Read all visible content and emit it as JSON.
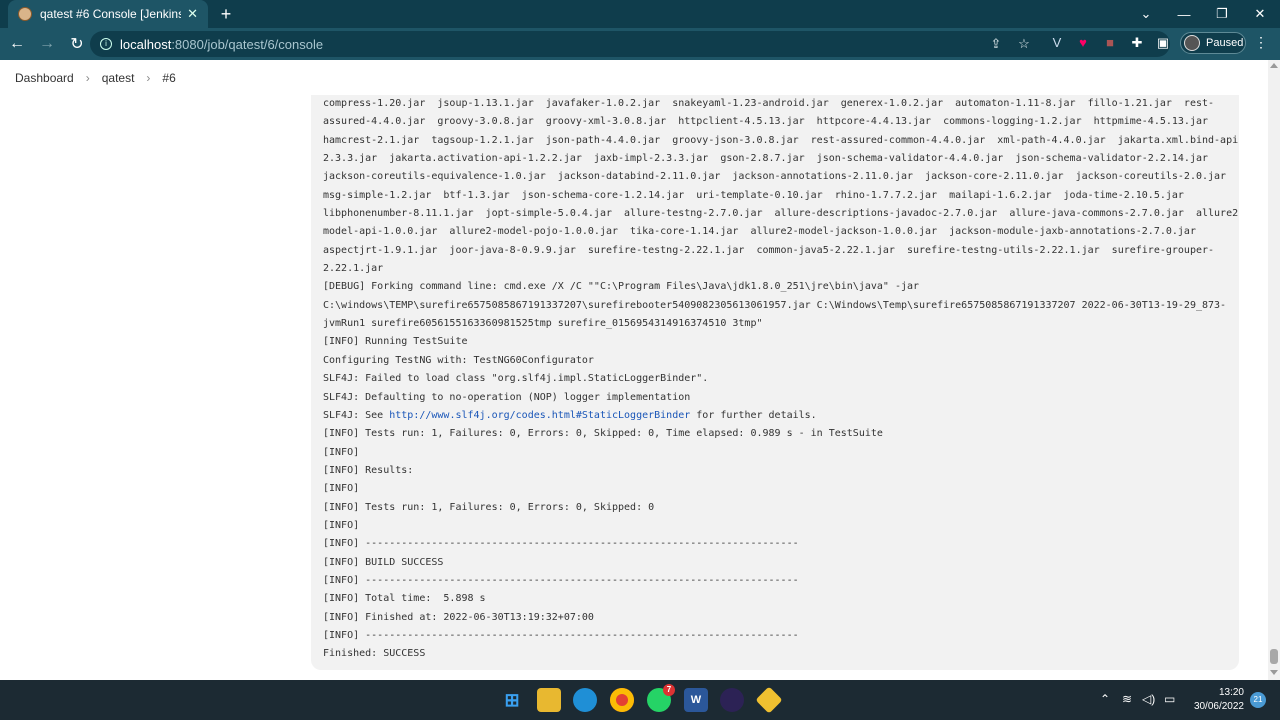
{
  "browser": {
    "tab_title": "qatest #6 Console [Jenkins]",
    "tab_close": "✕",
    "new_tab": "+",
    "url_host": "localhost",
    "url_path": ":8080/job/qatest/6/console",
    "profile_label": "Paused"
  },
  "breadcrumb": {
    "items": [
      "Dashboard",
      "qatest",
      "#6"
    ],
    "separator": "›"
  },
  "console": {
    "lines": [
      "compress-1.20.jar  jsoup-1.13.1.jar  javafaker-1.0.2.jar  snakeyaml-1.23-android.jar  generex-1.0.2.jar  automaton-1.11-8.jar  fillo-1.21.jar  rest-",
      "assured-4.4.0.jar  groovy-3.0.8.jar  groovy-xml-3.0.8.jar  httpclient-4.5.13.jar  httpcore-4.4.13.jar  commons-logging-1.2.jar  httpmime-4.5.13.jar",
      "hamcrest-2.1.jar  tagsoup-1.2.1.jar  json-path-4.4.0.jar  groovy-json-3.0.8.jar  rest-assured-common-4.4.0.jar  xml-path-4.4.0.jar  jakarta.xml.bind-api-",
      "2.3.3.jar  jakarta.activation-api-1.2.2.jar  jaxb-impl-2.3.3.jar  gson-2.8.7.jar  json-schema-validator-4.4.0.jar  json-schema-validator-2.2.14.jar",
      "jackson-coreutils-equivalence-1.0.jar  jackson-databind-2.11.0.jar  jackson-annotations-2.11.0.jar  jackson-core-2.11.0.jar  jackson-coreutils-2.0.jar",
      "msg-simple-1.2.jar  btf-1.3.jar  json-schema-core-1.2.14.jar  uri-template-0.10.jar  rhino-1.7.7.2.jar  mailapi-1.6.2.jar  joda-time-2.10.5.jar",
      "libphonenumber-8.11.1.jar  jopt-simple-5.0.4.jar  allure-testng-2.7.0.jar  allure-descriptions-javadoc-2.7.0.jar  allure-java-commons-2.7.0.jar  allure2-",
      "model-api-1.0.0.jar  allure2-model-pojo-1.0.0.jar  tika-core-1.14.jar  allure2-model-jackson-1.0.0.jar  jackson-module-jaxb-annotations-2.7.0.jar",
      "aspectjrt-1.9.1.jar  joor-java-8-0.9.9.jar  surefire-testng-2.22.1.jar  common-java5-2.22.1.jar  surefire-testng-utils-2.22.1.jar  surefire-grouper-",
      "2.22.1.jar",
      "[DEBUG] Forking command line: cmd.exe /X /C \"\"C:\\Program Files\\Java\\jdk1.8.0_251\\jre\\bin\\java\" -jar",
      "C:\\windows\\TEMP\\surefire6575085867191337207\\surefirebooter5409082305613061957.jar C:\\Windows\\Temp\\surefire6575085867191337207 2022-06-30T13-19-29_873-",
      "jvmRun1 surefire6056155163360981525tmp surefire_0156954314916374510 3tmp\"",
      "[INFO] Running TestSuite",
      "Configuring TestNG with: TestNG60Configurator",
      "SLF4J: Failed to load class \"org.slf4j.impl.StaticLoggerBinder\".",
      "SLF4J: Defaulting to no-operation (NOP) logger implementation",
      "[INFO] Tests run: 1, Failures: 0, Errors: 0, Skipped: 0, Time elapsed: 0.989 s - in TestSuite",
      "[INFO]",
      "[INFO] Results:",
      "[INFO]",
      "[INFO] Tests run: 1, Failures: 0, Errors: 0, Skipped: 0",
      "[INFO]",
      "[INFO] ------------------------------------------------------------------------",
      "[INFO] BUILD SUCCESS",
      "[INFO] ------------------------------------------------------------------------",
      "[INFO] Total time:  5.898 s",
      "[INFO] Finished at: 2022-06-30T13:19:32+07:00",
      "[INFO] ------------------------------------------------------------------------",
      "Finished: SUCCESS"
    ],
    "link_line": {
      "prefix": "SLF4J: See ",
      "link": "http://www.slf4j.org/codes.html#StaticLoggerBinder",
      "suffix": " for further details."
    }
  },
  "taskbar": {
    "whatsapp_badge": "7",
    "time": "13:20",
    "date": "30/06/2022",
    "notifications": "21"
  },
  "colors": {
    "browser_frame": "#0f3d4c",
    "toolbar": "#1e5566",
    "console_bg": "#f2f2f2",
    "link": "#1a56b8"
  }
}
